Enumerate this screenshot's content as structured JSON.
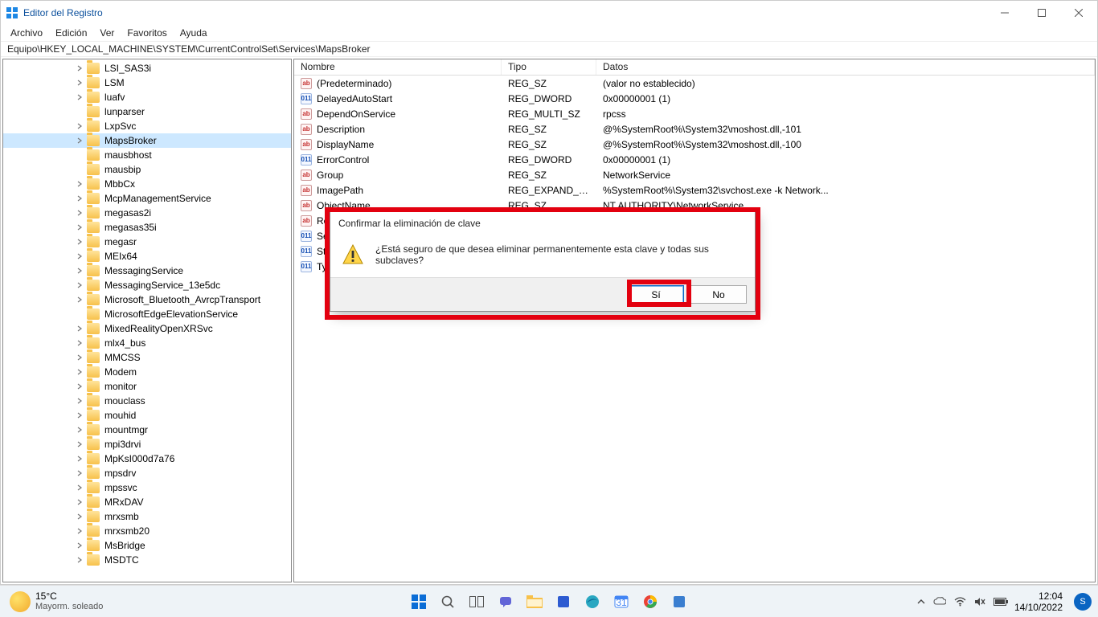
{
  "window": {
    "title": "Editor del Registro",
    "menu": [
      "Archivo",
      "Edición",
      "Ver",
      "Favoritos",
      "Ayuda"
    ],
    "address": "Equipo\\HKEY_LOCAL_MACHINE\\SYSTEM\\CurrentControlSet\\Services\\MapsBroker"
  },
  "tree": [
    {
      "e": true,
      "label": "LSI_SAS3i"
    },
    {
      "e": true,
      "label": "LSM"
    },
    {
      "e": true,
      "label": "luafv"
    },
    {
      "e": false,
      "label": "lunparser"
    },
    {
      "e": true,
      "label": "LxpSvc"
    },
    {
      "e": true,
      "label": "MapsBroker",
      "selected": true
    },
    {
      "e": false,
      "label": "mausbhost"
    },
    {
      "e": false,
      "label": "mausbip"
    },
    {
      "e": true,
      "label": "MbbCx"
    },
    {
      "e": true,
      "label": "McpManagementService"
    },
    {
      "e": true,
      "label": "megasas2i"
    },
    {
      "e": true,
      "label": "megasas35i"
    },
    {
      "e": true,
      "label": "megasr"
    },
    {
      "e": true,
      "label": "MEIx64"
    },
    {
      "e": true,
      "label": "MessagingService"
    },
    {
      "e": true,
      "label": "MessagingService_13e5dc"
    },
    {
      "e": true,
      "label": "Microsoft_Bluetooth_AvrcpTransport"
    },
    {
      "e": false,
      "label": "MicrosoftEdgeElevationService"
    },
    {
      "e": true,
      "label": "MixedRealityOpenXRSvc"
    },
    {
      "e": true,
      "label": "mlx4_bus"
    },
    {
      "e": true,
      "label": "MMCSS"
    },
    {
      "e": true,
      "label": "Modem"
    },
    {
      "e": true,
      "label": "monitor"
    },
    {
      "e": true,
      "label": "mouclass"
    },
    {
      "e": true,
      "label": "mouhid"
    },
    {
      "e": true,
      "label": "mountmgr"
    },
    {
      "e": true,
      "label": "mpi3drvi"
    },
    {
      "e": true,
      "label": "MpKsI000d7a76"
    },
    {
      "e": true,
      "label": "mpsdrv"
    },
    {
      "e": true,
      "label": "mpssvc"
    },
    {
      "e": true,
      "label": "MRxDAV"
    },
    {
      "e": true,
      "label": "mrxsmb"
    },
    {
      "e": true,
      "label": "mrxsmb20"
    },
    {
      "e": true,
      "label": "MsBridge"
    },
    {
      "e": true,
      "label": "MSDTC"
    }
  ],
  "list": {
    "headers": {
      "name": "Nombre",
      "type": "Tipo",
      "data": "Datos"
    },
    "rows": [
      {
        "icon": "str",
        "name": "(Predeterminado)",
        "type": "REG_SZ",
        "data": "(valor no establecido)"
      },
      {
        "icon": "bin",
        "name": "DelayedAutoStart",
        "type": "REG_DWORD",
        "data": "0x00000001 (1)"
      },
      {
        "icon": "str",
        "name": "DependOnService",
        "type": "REG_MULTI_SZ",
        "data": "rpcss"
      },
      {
        "icon": "str",
        "name": "Description",
        "type": "REG_SZ",
        "data": "@%SystemRoot%\\System32\\moshost.dll,-101"
      },
      {
        "icon": "str",
        "name": "DisplayName",
        "type": "REG_SZ",
        "data": "@%SystemRoot%\\System32\\moshost.dll,-100"
      },
      {
        "icon": "bin",
        "name": "ErrorControl",
        "type": "REG_DWORD",
        "data": "0x00000001 (1)"
      },
      {
        "icon": "str",
        "name": "Group",
        "type": "REG_SZ",
        "data": "NetworkService"
      },
      {
        "icon": "str",
        "name": "ImagePath",
        "type": "REG_EXPAND_SZ",
        "data": "%SystemRoot%\\System32\\svchost.exe -k Network..."
      },
      {
        "icon": "str",
        "name": "ObjectName",
        "type": "REG_SZ",
        "data": "NT AUTHORITY\\NetworkService"
      },
      {
        "icon": "str",
        "name": "Requ",
        "type": "",
        "data": ""
      },
      {
        "icon": "bin",
        "name": "Servi",
        "type": "",
        "data": ""
      },
      {
        "icon": "bin",
        "name": "Star",
        "type": "",
        "data": ""
      },
      {
        "icon": "bin",
        "name": "Type",
        "type": "",
        "data": ""
      }
    ]
  },
  "dialog": {
    "title": "Confirmar la eliminación de clave",
    "message": "¿Está seguro de que desea eliminar permanentemente esta clave y todas sus subclaves?",
    "yes": "Sí",
    "no": "No"
  },
  "taskbar": {
    "weather": {
      "temp": "15°C",
      "desc": "Mayorm. soleado"
    },
    "clock": {
      "time": "12:04",
      "date": "14/10/2022"
    },
    "user_initial": "S"
  }
}
